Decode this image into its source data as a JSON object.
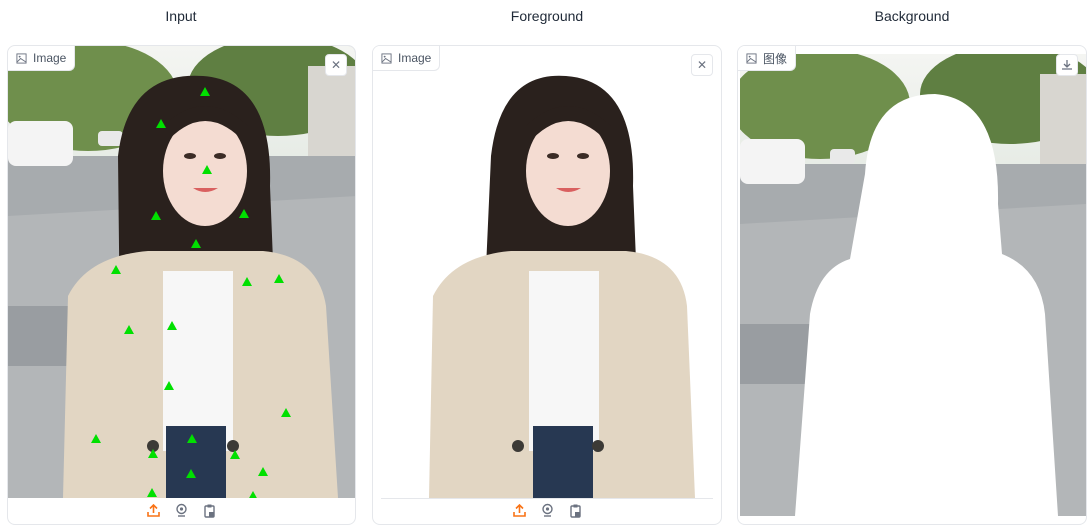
{
  "columns": [
    {
      "title": "Input",
      "label": "Image"
    },
    {
      "title": "Foreground",
      "label": "Image"
    },
    {
      "title": "Background",
      "label": "图像"
    }
  ],
  "icons": {
    "image": "image-icon",
    "close": "close-icon",
    "download": "download-icon",
    "upload": "upload-icon",
    "webcam": "webcam-icon",
    "clipboard": "clipboard-icon"
  },
  "colors": {
    "point_marker": "#00e000",
    "accent": "#f97316",
    "border": "#e5e7eb"
  }
}
